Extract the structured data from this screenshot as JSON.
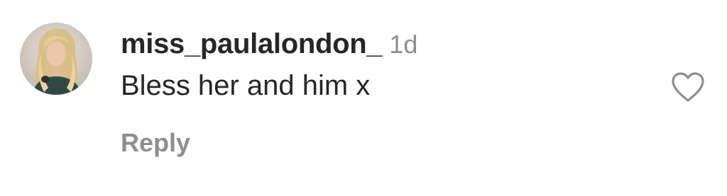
{
  "comment": {
    "avatar_icon": "profile-photo",
    "username": "miss_paulalondon_",
    "timestamp": "1d",
    "text": "Bless her and him x",
    "reply_label": "Reply",
    "like_icon": "heart-outline-icon"
  },
  "colors": {
    "username": "#262626",
    "secondary": "#8e8e8e",
    "icon": "#8e8e8e"
  }
}
